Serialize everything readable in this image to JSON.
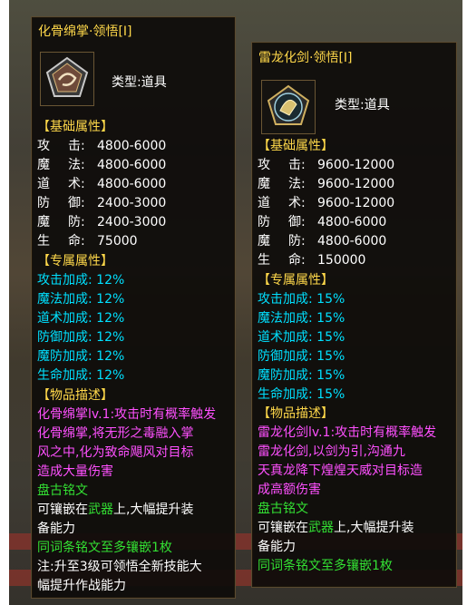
{
  "left_tooltip": {
    "title": "化骨绵掌·领悟[Ⅰ]",
    "icon": "swirl-rune-icon",
    "type_label": "类型:",
    "type_value": "道具",
    "base_header": "【基础属性】",
    "base_stats": [
      {
        "k1": "攻",
        "k2": "击:",
        "v": "4800-6000"
      },
      {
        "k1": "魔",
        "k2": "法:",
        "v": "4800-6000"
      },
      {
        "k1": "道",
        "k2": "术:",
        "v": "4800-6000"
      },
      {
        "k1": "防",
        "k2": "御:",
        "v": "2400-3000"
      },
      {
        "k1": "魔",
        "k2": "防:",
        "v": "2400-3000"
      },
      {
        "k1": "生",
        "k2": "命:",
        "v": "75000"
      }
    ],
    "special_header": "【专属属性】",
    "special_stats": [
      {
        "k": "攻击加成:",
        "v": "12%"
      },
      {
        "k": "魔法加成:",
        "v": "12%"
      },
      {
        "k": "道术加成:",
        "v": "12%"
      },
      {
        "k": "防御加成:",
        "v": "12%"
      },
      {
        "k": "魔防加成:",
        "v": "12%"
      },
      {
        "k": "生命加成:",
        "v": "12%"
      }
    ],
    "desc_header": "【物品描述】",
    "desc_lines": [
      "化骨绵掌lv.1:攻击时有概率触发",
      "化骨绵掌,将无形之毒融入掌",
      "风之中,化为致命飓风对目标",
      "造成大量伤害"
    ],
    "desc_sub": "盘古铭文",
    "embed_line1_a": "可镶嵌在",
    "embed_line1_b": "武器",
    "embed_line1_c": "上,大幅提升装",
    "embed_line2": "备能力",
    "embed_line3": "同词条铭文至多镶嵌1枚",
    "note_line1": "注:升至3级可领悟全新技能大",
    "note_line2": "幅提升作战能力"
  },
  "right_tooltip": {
    "title": "雷龙化剑·领悟[Ⅰ]",
    "icon": "dragon-sword-rune-icon",
    "type_label": "类型:",
    "type_value": "道具",
    "base_header": "【基础属性】",
    "base_stats": [
      {
        "k1": "攻",
        "k2": "击:",
        "v": "9600-12000"
      },
      {
        "k1": "魔",
        "k2": "法:",
        "v": "9600-12000"
      },
      {
        "k1": "道",
        "k2": "术:",
        "v": "9600-12000"
      },
      {
        "k1": "防",
        "k2": "御:",
        "v": "4800-6000"
      },
      {
        "k1": "魔",
        "k2": "防:",
        "v": "4800-6000"
      },
      {
        "k1": "生",
        "k2": "命:",
        "v": "150000"
      }
    ],
    "special_header": "【专属属性】",
    "special_stats": [
      {
        "k": "攻击加成:",
        "v": "15%"
      },
      {
        "k": "魔法加成:",
        "v": "15%"
      },
      {
        "k": "道术加成:",
        "v": "15%"
      },
      {
        "k": "防御加成:",
        "v": "15%"
      },
      {
        "k": "魔防加成:",
        "v": "15%"
      },
      {
        "k": "生命加成:",
        "v": "15%"
      }
    ],
    "desc_header": "【物品描述】",
    "desc_lines": [
      "雷龙化剑lv.1:攻击时有概率触发",
      "雷龙化剑,以剑为引,沟通九",
      "天真龙降下煌煌天威对目标造",
      "成高额伤害"
    ],
    "desc_sub": "盘古铭文",
    "embed_line1_a": "可镶嵌在",
    "embed_line1_b": "武器",
    "embed_line1_c": "上,大幅提升装",
    "embed_line2": "备能力",
    "embed_line3": "同词条铭文至多镶嵌1枚"
  },
  "colors": {
    "title": "#ffd84a",
    "special": "#00e0ff",
    "desc": "#ff50ff",
    "green": "#33e033"
  }
}
